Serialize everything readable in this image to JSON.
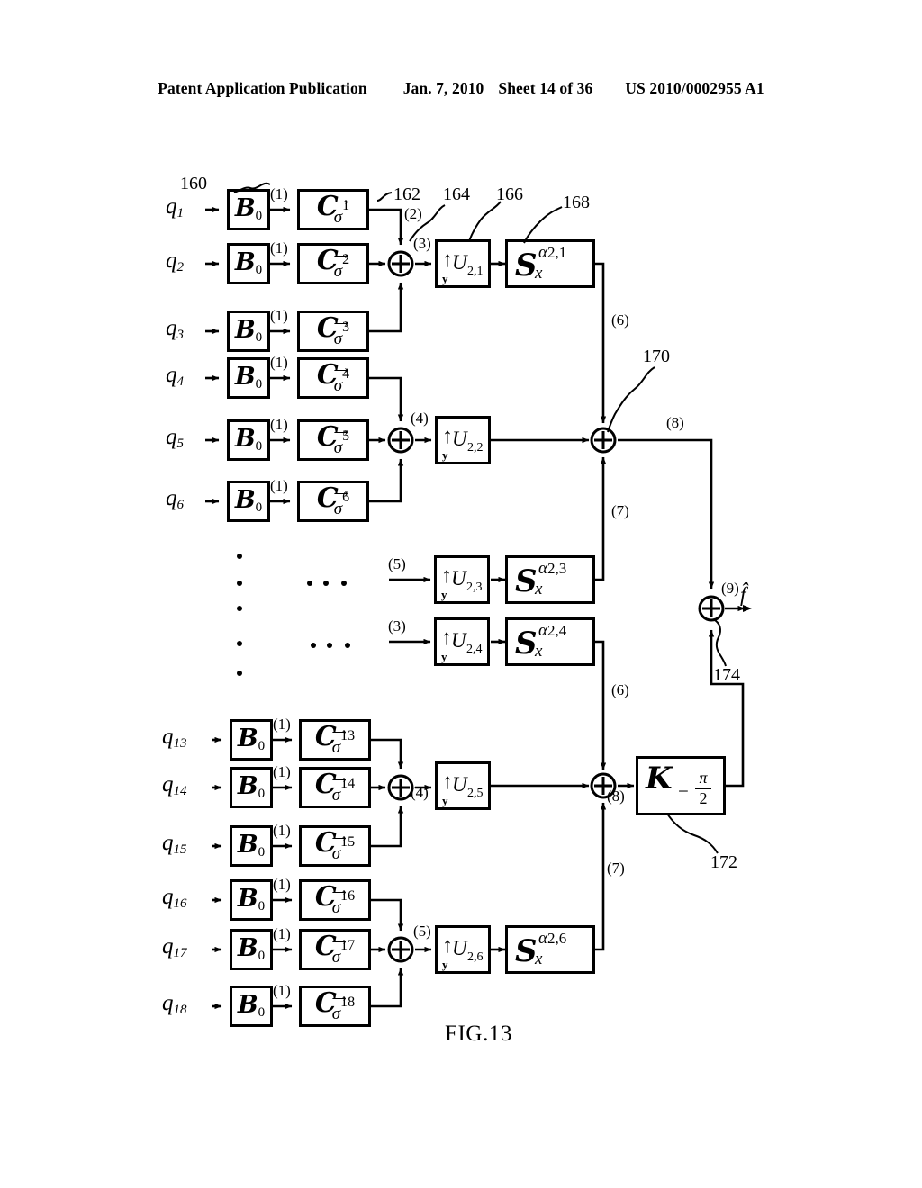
{
  "header": {
    "publication": "Patent Application Publication",
    "date": "Jan. 7, 2010",
    "sheet": "Sheet 14 of 36",
    "patent_number": "US 2010/0002955 A1"
  },
  "figure": {
    "caption": "FIG.13",
    "output_symbol": "f̂"
  },
  "reference_numbers": {
    "b_block": "160",
    "c_output_line": "162",
    "adder_1": "164",
    "u_block": "166",
    "s_block": "168",
    "adder_170": "170",
    "k_block": "172",
    "adder_174": "174"
  },
  "blocks": {
    "b_label": "B",
    "b_sub": "0",
    "c_label": "C",
    "c_sigma": "σ",
    "u_label": "U",
    "u_sub_y": "y",
    "s_label": "S",
    "s_sub": "x",
    "s_alpha": "α",
    "k_label": "K",
    "k_minus": "−",
    "k_num": "π",
    "k_den": "2"
  },
  "inputs": [
    {
      "name": "q",
      "sub": "1",
      "c_index": "1"
    },
    {
      "name": "q",
      "sub": "2",
      "c_index": "2"
    },
    {
      "name": "q",
      "sub": "3",
      "c_index": "3"
    },
    {
      "name": "q",
      "sub": "4",
      "c_index": "4"
    },
    {
      "name": "q",
      "sub": "5",
      "c_index": "5"
    },
    {
      "name": "q",
      "sub": "6",
      "c_index": "6"
    },
    {
      "name": "q",
      "sub": "13",
      "c_index": "13"
    },
    {
      "name": "q",
      "sub": "14",
      "c_index": "14"
    },
    {
      "name": "q",
      "sub": "15",
      "c_index": "15"
    },
    {
      "name": "q",
      "sub": "16",
      "c_index": "16"
    },
    {
      "name": "q",
      "sub": "17",
      "c_index": "17"
    },
    {
      "name": "q",
      "sub": "18",
      "c_index": "18"
    }
  ],
  "b_stage_labels": [
    "(1)",
    "(1)",
    "(1)",
    "(1)",
    "(1)",
    "(1)",
    "(1)",
    "(1)",
    "(1)",
    "(1)",
    "(1)",
    "(1)"
  ],
  "u_units": [
    {
      "index": "2,1",
      "input_label": "(3)"
    },
    {
      "index": "2,2",
      "input_label": "(4)"
    },
    {
      "index": "2,3",
      "input_label": "(5)"
    },
    {
      "index": "2,4",
      "input_label": "(3)"
    },
    {
      "index": "2,5",
      "input_label": "(4)"
    },
    {
      "index": "2,6",
      "input_label": "(5)"
    }
  ],
  "s_units": [
    {
      "index": "2,1"
    },
    {
      "index": "2,3"
    },
    {
      "index": "2,4"
    },
    {
      "index": "2,6"
    }
  ],
  "signal_labels": {
    "line_2": "(2)",
    "line_6_top": "(6)",
    "line_7_top": "(7)",
    "line_8_top": "(8)",
    "line_6_bottom": "(6)",
    "line_7_bottom": "(7)",
    "line_8_bottom": "(8)",
    "line_9": "(9)"
  },
  "ellipsis": {
    "vertical_dots": 5,
    "horizontal_rows": 2,
    "dots_per_row": 3
  },
  "colors": {
    "ink": "#000000",
    "paper": "#ffffff"
  }
}
